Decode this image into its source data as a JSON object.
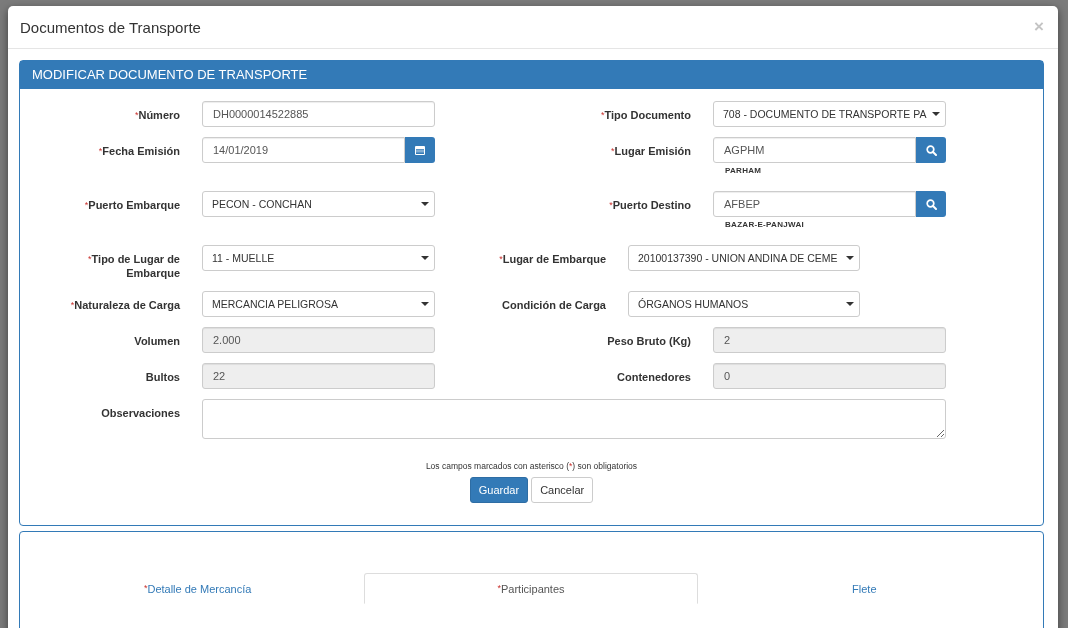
{
  "dialog": {
    "title": "Documentos de Transporte",
    "close": "×"
  },
  "panel": {
    "title": "MODIFICAR DOCUMENTO DE TRANSPORTE"
  },
  "rows": [
    {
      "left": {
        "label": "Número",
        "required": true,
        "kind": "text",
        "value": "DH0000014522885"
      },
      "right": {
        "label": "Tipo Documento",
        "required": true,
        "kind": "select",
        "value": "708 - DOCUMENTO DE TRANSPORTE PA"
      }
    },
    {
      "left": {
        "label": "Fecha Emisión",
        "required": true,
        "kind": "date",
        "value": "14/01/2019"
      },
      "right": {
        "label": "Lugar Emisión",
        "required": true,
        "kind": "lookup",
        "value": "AGPHM",
        "caption": "PARHAM"
      }
    },
    {
      "left": {
        "label": "Puerto Embarque",
        "required": true,
        "kind": "select",
        "value": "PECON - CONCHAN"
      },
      "right": {
        "label": "Puerto Destino",
        "required": true,
        "kind": "lookup",
        "value": "AFBEP",
        "caption": "BAZAR-E-PANJWAI"
      }
    },
    {
      "left": {
        "label": "Tipo de Lugar de Embarque",
        "required": true,
        "kind": "select",
        "value": "11 - MUELLE"
      },
      "right": {
        "label": "Lugar de Embarque",
        "required": true,
        "kind": "select",
        "value": "20100137390 - UNION ANDINA DE CEME"
      }
    },
    {
      "left": {
        "label": "Naturaleza de Carga",
        "required": true,
        "kind": "select",
        "value": "MERCANCIA PELIGROSA"
      },
      "right": {
        "label": "Condición de Carga",
        "required": false,
        "kind": "select",
        "value": "ÓRGANOS HUMANOS"
      }
    },
    {
      "left": {
        "label": "Volumen",
        "required": false,
        "kind": "readonly",
        "value": "2.000"
      },
      "right": {
        "label": "Peso Bruto (Kg)",
        "required": false,
        "kind": "readonly",
        "value": "2"
      }
    },
    {
      "left": {
        "label": "Bultos",
        "required": false,
        "kind": "readonly",
        "value": "22"
      },
      "right": {
        "label": "Contenedores",
        "required": false,
        "kind": "readonly",
        "value": "0"
      }
    }
  ],
  "observaciones": {
    "label": "Observaciones"
  },
  "note": {
    "before": "Los campos marcados con asterisco (",
    "mark": "*",
    "after": ") son obligatorios"
  },
  "buttons": [
    {
      "label": "Guardar",
      "kind": "primary"
    },
    {
      "label": "Cancelar",
      "kind": "default"
    }
  ],
  "tabs": [
    {
      "label": "Detalle de Mercancía",
      "required": true,
      "selected": false
    },
    {
      "label": "Participantes",
      "required": true,
      "selected": true
    },
    {
      "label": "Flete",
      "required": false,
      "selected": false
    }
  ]
}
